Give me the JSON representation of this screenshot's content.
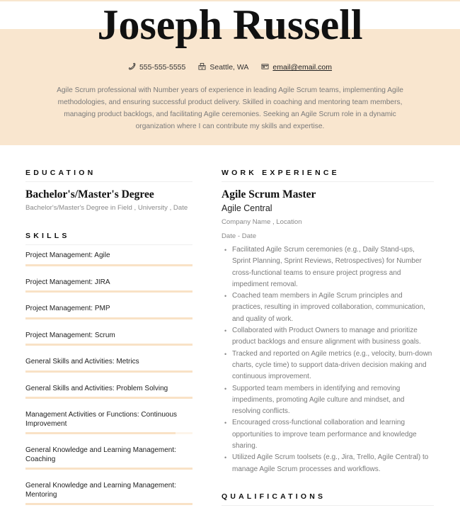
{
  "header": {
    "name": "Joseph Russell",
    "phone": "555-555-5555",
    "location": "Seattle, WA",
    "email": "email@email.com",
    "summary": "Agile Scrum professional with Number years of experience in leading Agile Scrum teams, implementing Agile methodologies, and ensuring successful product delivery. Skilled in coaching and mentoring team members, managing product backlogs, and facilitating Agile ceremonies. Seeking an Agile Scrum role in a dynamic organization where I can contribute my skills and expertise.",
    "icons": {
      "phone": "phone-icon",
      "location": "building-icon",
      "email": "envelope-icon"
    }
  },
  "colors": {
    "accent": "#f9e6cf",
    "skill_fill": "#f9e2c6",
    "skill_track": "#fdf5ea"
  },
  "education": {
    "title": "EDUCATION",
    "degree": "Bachelor's/Master's Degree",
    "detail": "Bachelor's/Master's Degree in Field , University , Date"
  },
  "skills": {
    "title": "SKILLS",
    "items": [
      {
        "label": "Project Management: Agile",
        "level": 100
      },
      {
        "label": "Project Management: JIRA",
        "level": 100
      },
      {
        "label": "Project Management: PMP",
        "level": 100
      },
      {
        "label": "Project Management: Scrum",
        "level": 100
      },
      {
        "label": "General Skills and Activities: Metrics",
        "level": 100
      },
      {
        "label": "General Skills and Activities: Problem Solving",
        "level": 100
      },
      {
        "label": "Management Activities or Functions: Continuous Improvement",
        "level": 90
      },
      {
        "label": "General Knowledge and Learning Management: Coaching",
        "level": 100
      },
      {
        "label": "General Knowledge and Learning Management: Mentoring",
        "level": 100
      }
    ]
  },
  "work": {
    "title": "WORK EXPERIENCE",
    "job_title": "Agile Scrum Master",
    "company": "Agile Central",
    "company_location": "Company Name , Location",
    "dates": "Date - Date",
    "bullets": [
      "Facilitated Agile Scrum ceremonies (e.g., Daily Stand-ups, Sprint Planning, Sprint Reviews, Retrospectives) for Number cross-functional teams to ensure project progress and impediment removal.",
      "Coached team members in Agile Scrum principles and practices, resulting in improved collaboration, communication, and quality of work.",
      "Collaborated with Product Owners to manage and prioritize product backlogs and ensure alignment with business goals.",
      "Tracked and reported on Agile metrics (e.g., velocity, burn-down charts, cycle time) to support data-driven decision making and continuous improvement.",
      "Supported team members in identifying and removing impediments, promoting Agile culture and mindset, and resolving conflicts.",
      "Encouraged cross-functional collaboration and learning opportunities to improve team performance and knowledge sharing.",
      "Utilized Agile Scrum toolsets (e.g., Jira, Trello, Agile Central) to manage Agile Scrum processes and workflows."
    ]
  },
  "qualifications": {
    "title": "QUALIFICATIONS"
  }
}
